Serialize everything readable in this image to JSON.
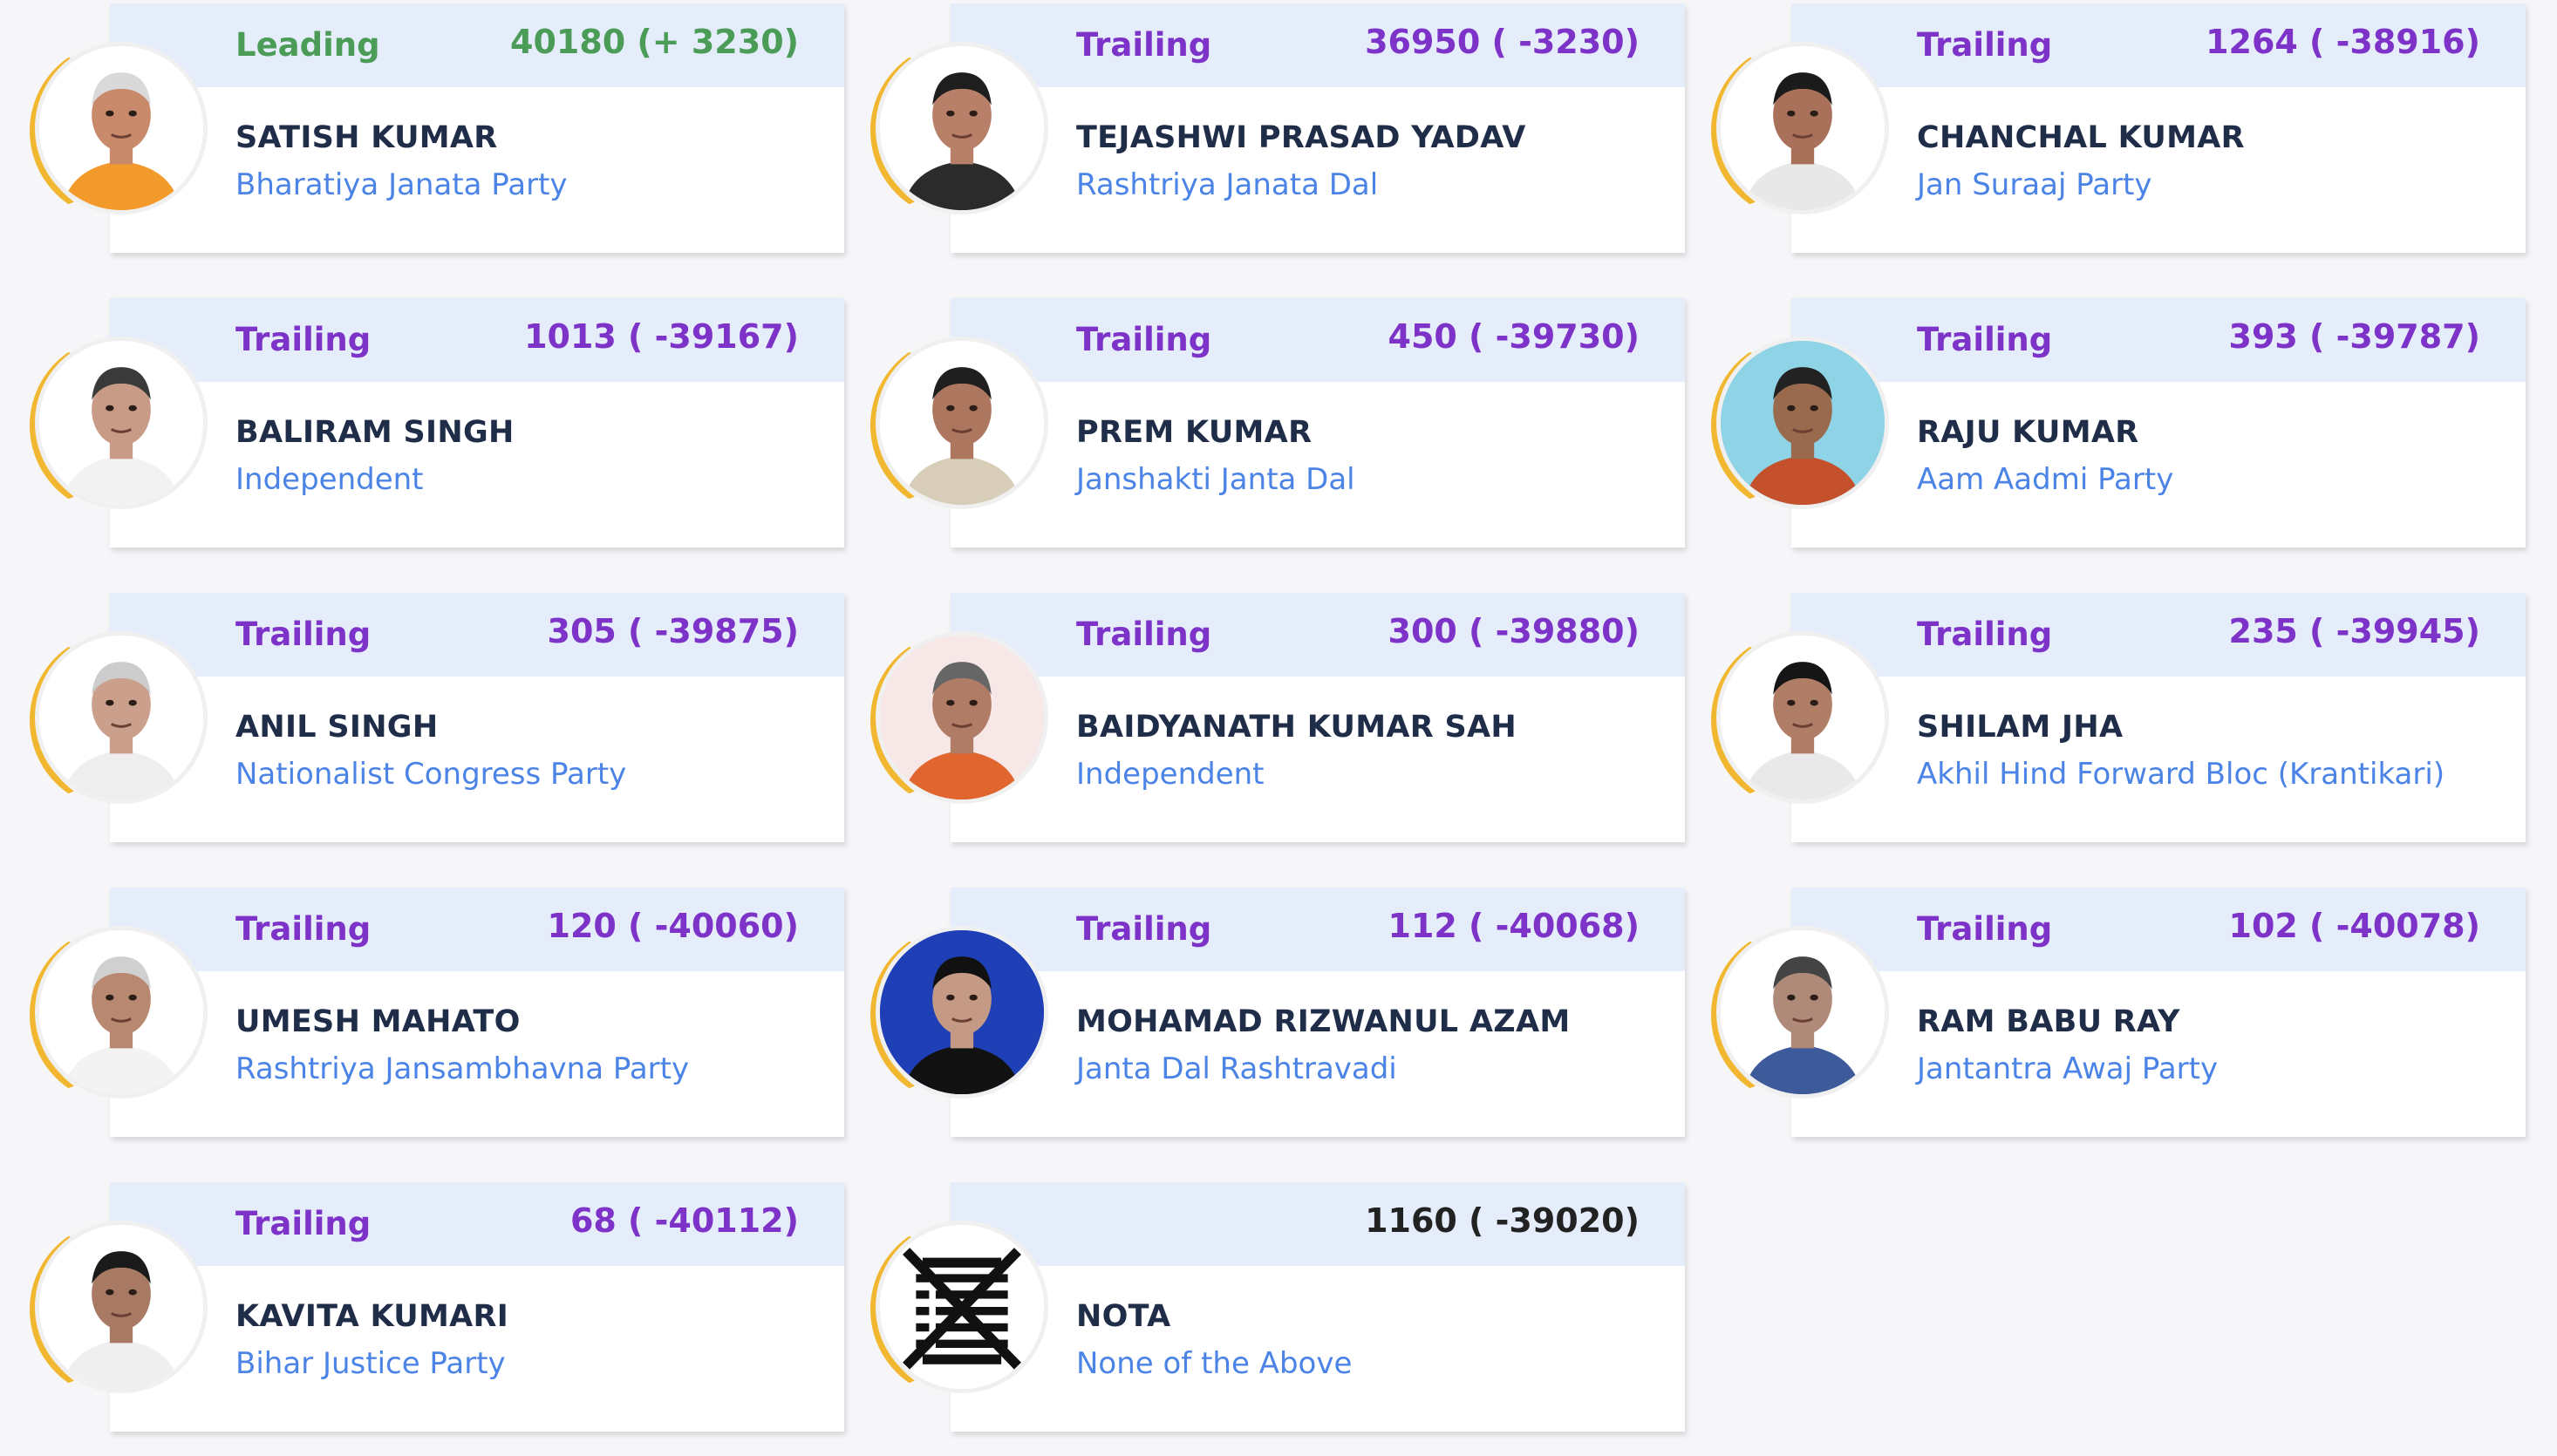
{
  "candidates": [
    {
      "status": "Leading",
      "votes": "40180 (+ 3230)",
      "name": "SATISH KUMAR",
      "party": "Bharatiya Janata Party",
      "tone": "leading",
      "photo": {
        "bg": "#ffffff",
        "skin": "#c98a6c",
        "hair": "#d9d9d9",
        "shirt": "#f39a2c"
      }
    },
    {
      "status": "Trailing",
      "votes": "36950 ( -3230)",
      "name": "TEJASHWI PRASAD YADAV",
      "party": "Rashtriya Janata Dal",
      "tone": "trailing",
      "photo": {
        "bg": "#ffffff",
        "skin": "#b88068",
        "hair": "#1e1e1e",
        "shirt": "#2b2b2b"
      }
    },
    {
      "status": "Trailing",
      "votes": "1264 ( -38916)",
      "name": "CHANCHAL KUMAR",
      "party": "Jan Suraaj Party",
      "tone": "trailing",
      "photo": {
        "bg": "#ffffff",
        "skin": "#a9715a",
        "hair": "#1b1b1b",
        "shirt": "#e8e8e8"
      }
    },
    {
      "status": "Trailing",
      "votes": "1013 ( -39167)",
      "name": "BALIRAM SINGH",
      "party": "Independent",
      "tone": "trailing",
      "photo": {
        "bg": "#ffffff",
        "skin": "#c79b86",
        "hair": "#3a3a3a",
        "shirt": "#f2f2f2"
      }
    },
    {
      "status": "Trailing",
      "votes": "450 ( -39730)",
      "name": "PREM KUMAR",
      "party": "Janshakti Janta Dal",
      "tone": "trailing",
      "photo": {
        "bg": "#ffffff",
        "skin": "#ad765e",
        "hair": "#1f1f1f",
        "shirt": "#d8cdb8"
      }
    },
    {
      "status": "Trailing",
      "votes": "393 ( -39787)",
      "name": "RAJU KUMAR",
      "party": "Aam Aadmi Party",
      "tone": "trailing",
      "photo": {
        "bg": "#8fd3e6",
        "skin": "#9a6a4e",
        "hair": "#222222",
        "shirt": "#c4512b"
      }
    },
    {
      "status": "Trailing",
      "votes": "305 ( -39875)",
      "name": "ANIL SINGH",
      "party": "Nationalist Congress Party",
      "tone": "trailing",
      "photo": {
        "bg": "#ffffff",
        "skin": "#caa08c",
        "hair": "#cccccc",
        "shirt": "#eeeeee"
      }
    },
    {
      "status": "Trailing",
      "votes": "300 ( -39880)",
      "name": "BAIDYANATH KUMAR SAH",
      "party": "Independent",
      "tone": "trailing",
      "photo": {
        "bg": "#f7e7e7",
        "skin": "#b07c66",
        "hair": "#666666",
        "shirt": "#e1652e"
      }
    },
    {
      "status": "Trailing",
      "votes": "235 ( -39945)",
      "name": "SHILAM JHA",
      "party": "Akhil Hind Forward Bloc (Krantikari)",
      "tone": "trailing",
      "photo": {
        "bg": "#ffffff",
        "skin": "#b07d66",
        "hair": "#151515",
        "shirt": "#e9e9e9"
      }
    },
    {
      "status": "Trailing",
      "votes": "120 ( -40060)",
      "name": "UMESH MAHATO",
      "party": "Rashtriya Jansambhavna Party",
      "tone": "trailing",
      "photo": {
        "bg": "#ffffff",
        "skin": "#b98870",
        "hair": "#d0d0d0",
        "shirt": "#f3f3f3"
      }
    },
    {
      "status": "Trailing",
      "votes": "112 ( -40068)",
      "name": "MOHAMAD RIZWANUL AZAM",
      "party": "Janta Dal Rashtravadi",
      "tone": "trailing",
      "photo": {
        "bg": "#1f3fb6",
        "skin": "#c49a84",
        "hair": "#111111",
        "shirt": "#121212"
      }
    },
    {
      "status": "Trailing",
      "votes": "102 ( -40078)",
      "name": "RAM BABU RAY",
      "party": "Jantantra Awaj Party",
      "tone": "trailing",
      "photo": {
        "bg": "#ffffff",
        "skin": "#b08a78",
        "hair": "#444444",
        "shirt": "#3d5a9a"
      }
    },
    {
      "status": "Trailing",
      "votes": "68 ( -40112)",
      "name": "KAVITA KUMARI",
      "party": "Bihar Justice Party",
      "tone": "trailing",
      "photo": {
        "bg": "#ffffff",
        "skin": "#a87a64",
        "hair": "#1a1a1a",
        "shirt": "#efefef"
      }
    },
    {
      "status": "",
      "votes": "1160 ( -39020)",
      "name": "NOTA",
      "party": "None of the Above",
      "tone": "neutral",
      "photo": {
        "bg": "#ffffff",
        "nota": true
      }
    }
  ]
}
